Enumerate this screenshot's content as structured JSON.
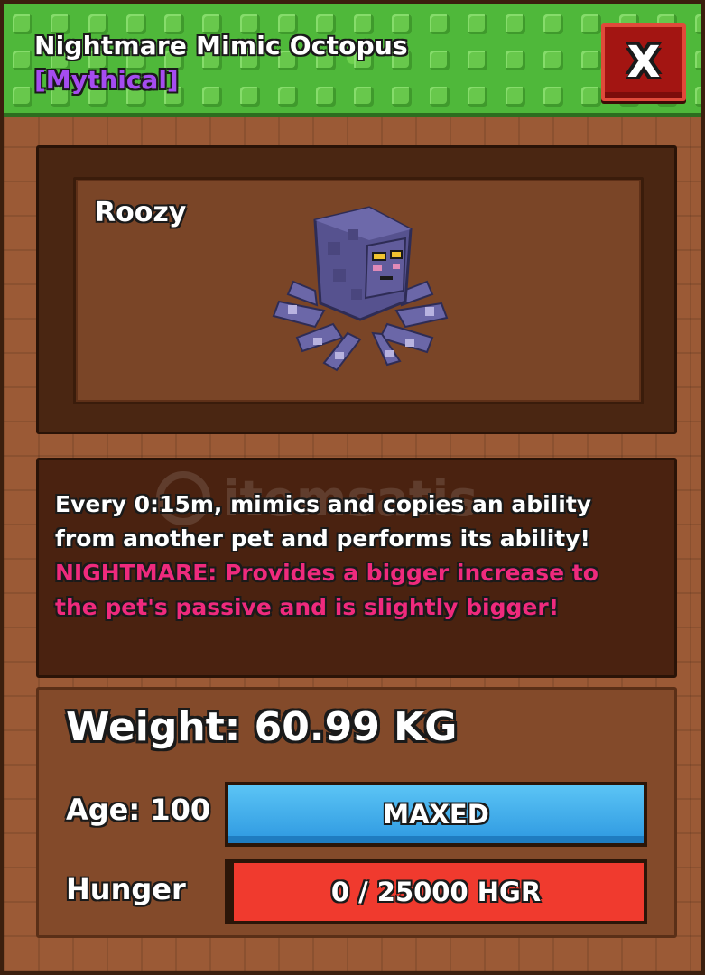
{
  "header": {
    "title": "Nightmare Mimic Octopus",
    "rarity": "[Mythical]",
    "close_label": "X",
    "colors": {
      "header_green": "#4fb83a",
      "rarity_purple": "#a54cf0",
      "close_red": "#a31512"
    }
  },
  "preview": {
    "pet_name": "Roozy",
    "model_icon": "octopus-pet-model"
  },
  "description": {
    "watermark": "itemsatis",
    "main_lines": [
      "Every 0:15m, mimics and copies an ability",
      "from another pet and performs its ability!"
    ],
    "nightmare_lines": [
      "NIGHTMARE: Provides a bigger increase to",
      "the pet's passive and is slightly bigger!"
    ],
    "colors": {
      "main": "#ffffff",
      "nightmare": "#ef2a7d"
    }
  },
  "stats": {
    "weight": "Weight: 60.99 KG",
    "age_label": "Age: 100",
    "age_bar_text": "MAXED",
    "hunger_label": "Hunger",
    "hunger_bar_text": "0 / 25000 HGR",
    "hunger_value": 0,
    "hunger_max": 25000,
    "colors": {
      "age_bar": "#2d98e0",
      "hunger_bar": "#f03a2e"
    }
  }
}
